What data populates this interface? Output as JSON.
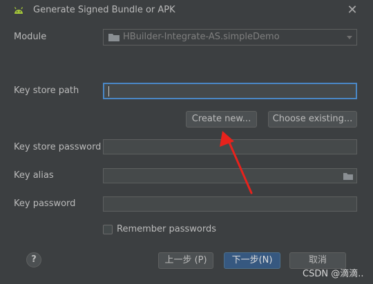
{
  "window": {
    "title": "Generate Signed Bundle or APK",
    "close_symbol": "✕"
  },
  "module": {
    "label": "Module",
    "value": "HBuilder-Integrate-AS.simpleDemo"
  },
  "key_store_path": {
    "label": "Key store path",
    "value": ""
  },
  "buttons": {
    "create_new": "Create new...",
    "choose_existing": "Choose existing...",
    "previous": "上一步 (P)",
    "next": "下一步(N)",
    "cancel": "取消",
    "help": "?"
  },
  "key_store_password": {
    "label": "Key store password",
    "value": ""
  },
  "key_alias": {
    "label": "Key alias",
    "value": ""
  },
  "key_password": {
    "label": "Key password",
    "value": ""
  },
  "remember": {
    "label": "Remember passwords",
    "checked": false
  },
  "watermark": "CSDN @滴滴..",
  "colors": {
    "background": "#3c3f41",
    "field": "#45494a",
    "focus": "#4a88c7",
    "primary": "#365880",
    "annotation_arrow": "#e8221c",
    "android": "#a4c639"
  },
  "icons": [
    "android-icon",
    "close-icon",
    "folder-icon",
    "dropdown-arrow-icon",
    "help-icon",
    "annotation-arrow"
  ]
}
